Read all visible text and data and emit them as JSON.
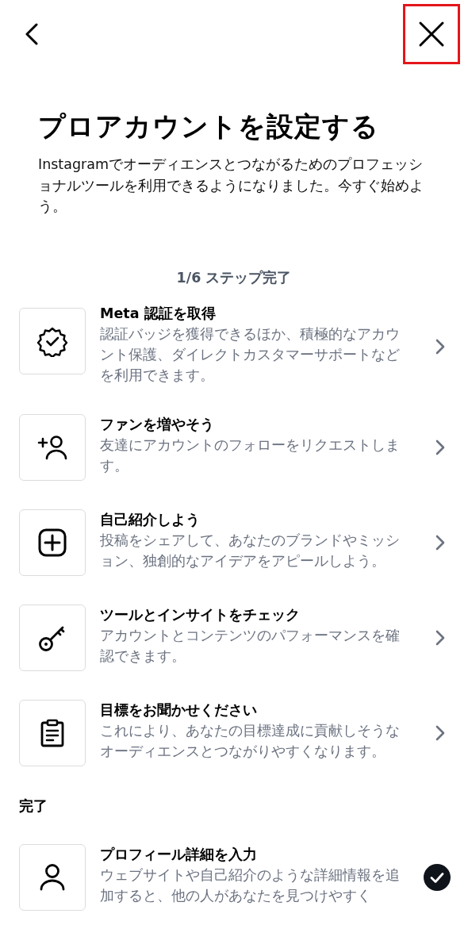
{
  "header": {
    "close_highlighted": true
  },
  "title": "プロアカウントを設定する",
  "intro": "Instagramでオーディエンスとつながるためのプロフェッショナルツールを利用できるようになりました。今すぐ始めよう。",
  "progress": "1/6 ステップ完了",
  "steps": [
    {
      "title": "Meta 認証を取得",
      "description": "認証バッジを獲得できるほか、積極的なアカウント保護、ダイレクトカスタマーサポートなどを利用できます。",
      "completed": false
    },
    {
      "title": "ファンを増やそう",
      "description": "友達にアカウントのフォローをリクエストします。",
      "completed": false
    },
    {
      "title": "自己紹介しよう",
      "description": "投稿をシェアして、あなたのブランドやミッション、独創的なアイデアをアピールしよう。",
      "completed": false
    },
    {
      "title": "ツールとインサイトをチェック",
      "description": "アカウントとコンテンツのパフォーマンスを確認できます。",
      "completed": false
    },
    {
      "title": "目標をお聞かせください",
      "description": "これにより、あなたの目標達成に貢献しそうなオーディエンスとつながりやすくなります。",
      "completed": false
    }
  ],
  "done_section": {
    "heading": "完了",
    "steps": [
      {
        "title": "プロフィール詳細を入力",
        "description": "ウェブサイトや自己紹介のような詳細情報を追加すると、他の人があなたを見つけやすく",
        "completed": true
      }
    ]
  }
}
